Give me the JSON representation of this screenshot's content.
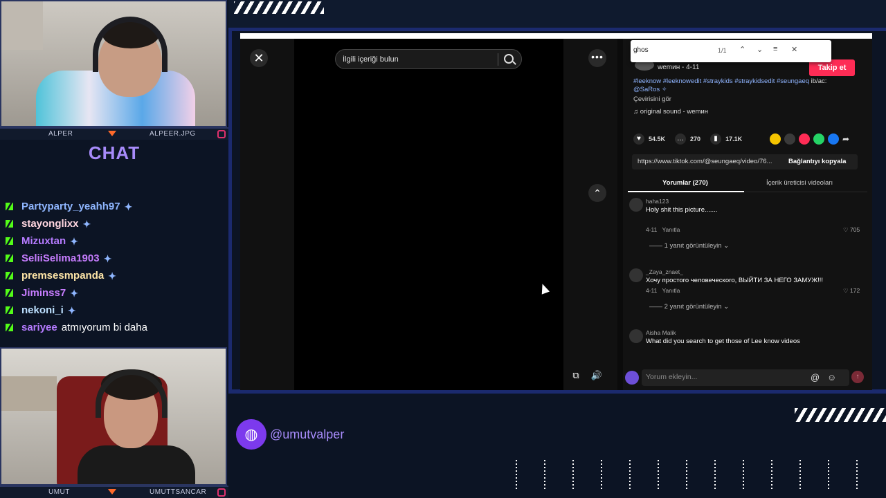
{
  "stream": {
    "chat_title": "CHAT",
    "cam_top": {
      "left_name": "ALPER",
      "right_name": "ALPEER.JPG"
    },
    "cam_bottom": {
      "left_name": "UMUT",
      "right_name": "UMUTTSANCAR"
    },
    "social_handle": "@umutvalper"
  },
  "chat": {
    "messages": [
      {
        "user": "Partyparty_yeahh97",
        "color": "#8fb6ff",
        "text": ""
      },
      {
        "user": "stayonglixx",
        "color": "#ffd6e0",
        "text": ""
      },
      {
        "user": "Mizuxtan",
        "color": "#b57bff",
        "text": ""
      },
      {
        "user": "SeliiSelima1903",
        "color": "#c77dff",
        "text": ""
      },
      {
        "user": "premsesmpanda",
        "color": "#ffe6a8",
        "text": ""
      },
      {
        "user": "Jiminss7",
        "color": "#c77dff",
        "text": ""
      },
      {
        "user": "nekoni_i",
        "color": "#bde0ff",
        "text": ""
      },
      {
        "user": "sariyee",
        "color": "#b57bff",
        "text": "atmıyorum bi daha"
      }
    ]
  },
  "tiktok": {
    "search_placeholder": "İlgili içeriği bulun",
    "find_query": "ghos",
    "find_count": "1/1",
    "follow_label": "Takip et",
    "author": "wemин - 4-11",
    "hashtags": "#leeknow #leeknowedit #straykids #straykidsedit #seungaeq",
    "credit_suffix": "ib/ac:",
    "mention": "@SaRos ✧",
    "see_translation": "Çevirisini gör",
    "sound": "original sound - wemин",
    "likes": "54.5K",
    "comments_count": "270",
    "saves": "17.1K",
    "link_url": "https://www.tiktok.com/@seungaeq/video/76...",
    "copy_link_label": "Bağlantıyı kopyala",
    "tab_comments": "Yorumlar (270)",
    "tab_creator": "İçerik üreticisi videoları",
    "comment_placeholder": "Yorum ekleyin...",
    "comments": [
      {
        "user": "haha123",
        "text": "Holy shit this picture.......",
        "date": "4-11",
        "reply_label": "Yanıtla",
        "likes": "705",
        "view_replies": "1 yanıt görüntüleyin"
      },
      {
        "user": "_Zaya_znaet_",
        "text": "Хочу простого человеческого, ВЫЙТИ ЗА НЕГО ЗАМУЖ!!!",
        "date": "4-11",
        "reply_label": "Yanıtla",
        "likes": "172",
        "view_replies": "2 yanıt görüntüleyin"
      },
      {
        "user": "Aisha Malik",
        "text": "What did you search to get those of Lee know videos"
      }
    ]
  },
  "colors": {
    "accent": "#a78bfa",
    "kick": "#53fc18",
    "follow": "#fe2c55"
  }
}
